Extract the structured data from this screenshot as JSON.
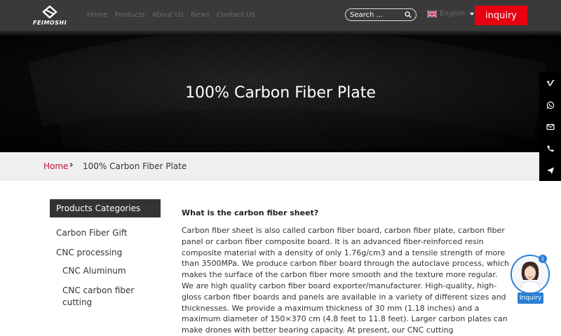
{
  "brand": {
    "name": "FEIMOSHI"
  },
  "nav": {
    "items": [
      "Home",
      "Products",
      "About Us",
      "News",
      "Contact Us"
    ]
  },
  "search": {
    "placeholder": "Search ..."
  },
  "language": {
    "label": "English"
  },
  "header": {
    "inquiry_label": "inquiry"
  },
  "hero": {
    "title": "100% Carbon Fiber Plate"
  },
  "breadcrumb": {
    "home": "Home",
    "current": "100% Carbon Fiber Plate"
  },
  "sidebar": {
    "heading": "Products Categories",
    "items": [
      "Carbon Fiber Gift",
      "CNC processing",
      "CNC Aluminum",
      "CNC carbon fiber cutting"
    ]
  },
  "content": {
    "heading": "What is the carbon fiber sheet?",
    "paragraph": "Carbon fiber sheet is also called carbon fiber board, carbon fiber plate, carbon fiber panel or carbon fiber composite board. It is an advanced fiber-reinforced resin composite material with a density of only 1.76g/cm3 and a tensile strength of more than 3500MPa. We produce carbon fiber board through the autoclave process, which makes the surface of the carbon fiber more smooth and the texture more regular. We are high quality carbon fiber board exporter/manufacturer. High-quality, high-gloss carbon fiber boards and panels are available in a variety of different sizes and thicknesses. We provide a maximum thickness of 30 mm (1.18 inches) and a maximum diameter of 150×370 cm (4.8 feet to 11.8 feet). Larger carbon plates can make drones with better bearing capacity. At present, our CNC cutting"
  },
  "social": {
    "icons": [
      "vimeo-icon",
      "whatsapp-icon",
      "email-icon",
      "phone-icon",
      "telegram-icon"
    ]
  },
  "chat": {
    "badge": "1",
    "label": "Inquiry"
  },
  "colors": {
    "accent": "#e60012",
    "header_bg": "#3a3a3a",
    "chat_blue": "#2a7fd4"
  }
}
